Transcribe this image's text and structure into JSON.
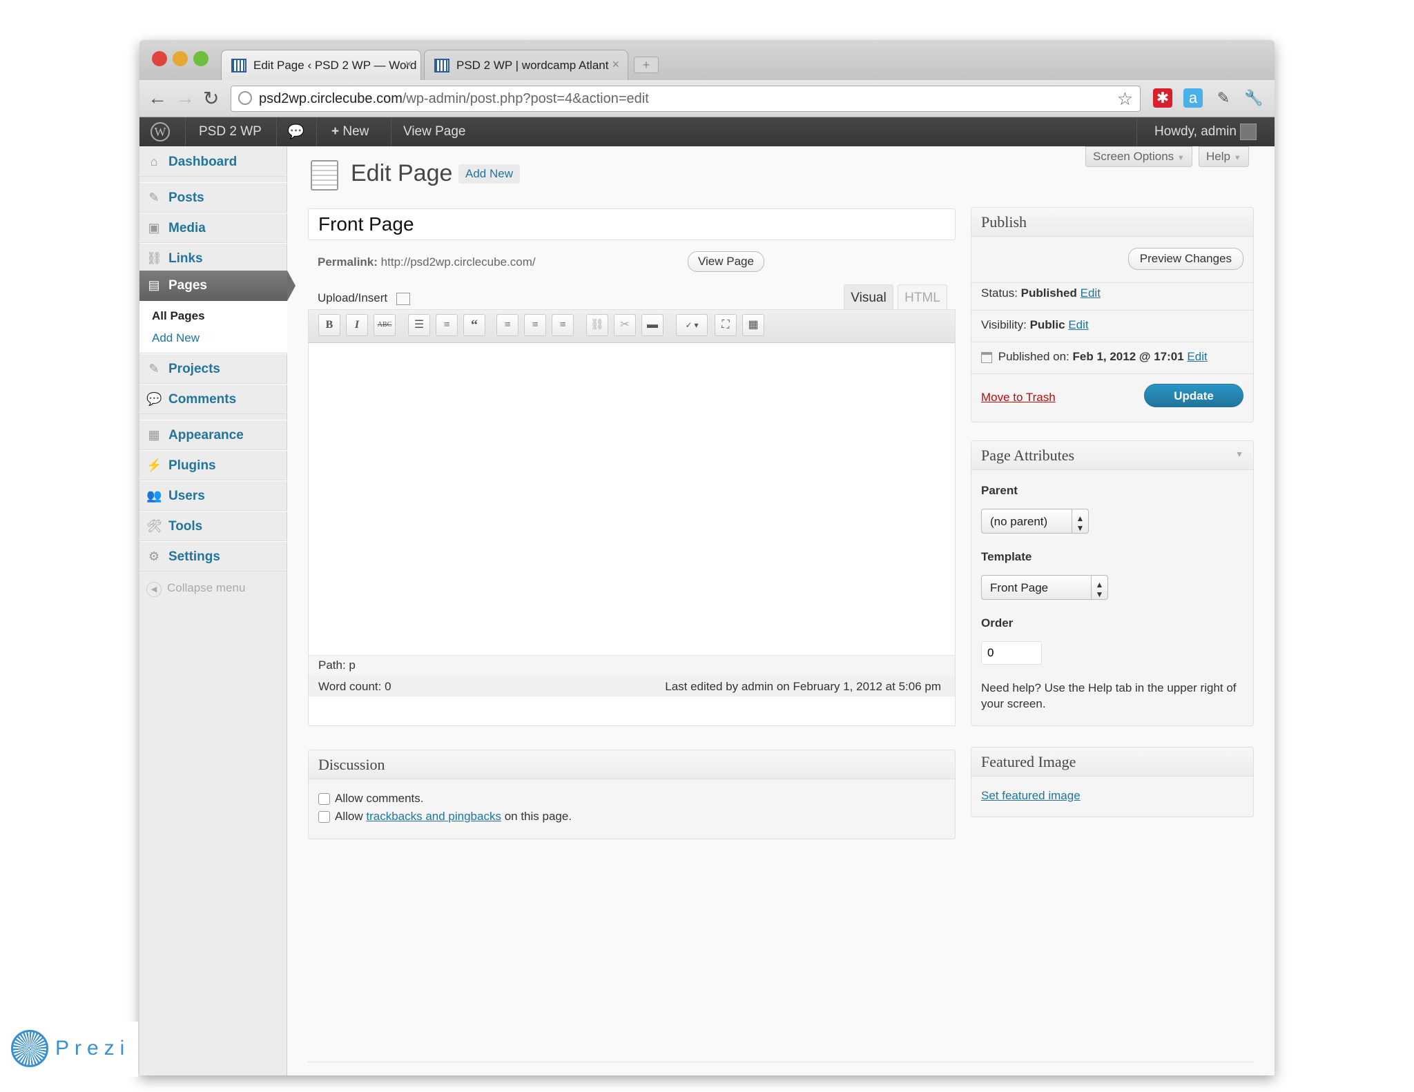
{
  "browser": {
    "tabs": [
      {
        "title": "Edit Page ‹ PSD 2 WP — Word",
        "active": true
      },
      {
        "title": "PSD 2 WP | wordcamp Atlant",
        "active": false
      }
    ],
    "url_host": "psd2wp.circlecube.com",
    "url_path": "/wp-admin/post.php?post=4&action=edit"
  },
  "adminbar": {
    "site_name": "PSD 2 WP",
    "new_label": "New",
    "view_page": "View Page",
    "howdy": "Howdy, admin"
  },
  "sidebar": {
    "items": [
      {
        "label": "Dashboard",
        "icon": "dashboard-icon"
      },
      {
        "label": "Posts",
        "icon": "pin-icon"
      },
      {
        "label": "Media",
        "icon": "media-icon"
      },
      {
        "label": "Links",
        "icon": "link-icon"
      },
      {
        "label": "Pages",
        "icon": "pages-icon"
      },
      {
        "label": "Projects",
        "icon": "pin-icon"
      },
      {
        "label": "Comments",
        "icon": "comment-icon"
      },
      {
        "label": "Appearance",
        "icon": "appearance-icon"
      },
      {
        "label": "Plugins",
        "icon": "plugin-icon"
      },
      {
        "label": "Users",
        "icon": "users-icon"
      },
      {
        "label": "Tools",
        "icon": "tools-icon"
      },
      {
        "label": "Settings",
        "icon": "settings-icon"
      }
    ],
    "submenu": {
      "all_pages": "All Pages",
      "add_new": "Add New"
    },
    "collapse": "Collapse menu"
  },
  "screen_options": "Screen Options",
  "help": "Help",
  "heading": {
    "title": "Edit Page",
    "add_new": "Add New"
  },
  "editor": {
    "post_title": "Front Page",
    "permalink_label": "Permalink:",
    "permalink_url": "http://psd2wp.circlecube.com/",
    "view_page_button": "View Page",
    "upload_insert": "Upload/Insert",
    "tab_visual": "Visual",
    "tab_html": "HTML",
    "path": "Path: p",
    "word_count": "Word count: 0",
    "last_edited": "Last edited by admin on February 1, 2012 at 5:06 pm"
  },
  "discussion": {
    "title": "Discussion",
    "allow_comments": "Allow comments.",
    "allow_prefix": "Allow",
    "trackbacks_link": "trackbacks and pingbacks",
    "allow_suffix": "on this page."
  },
  "publish": {
    "title": "Publish",
    "preview_button": "Preview Changes",
    "status_label": "Status:",
    "status_value": "Published",
    "visibility_label": "Visibility:",
    "visibility_value": "Public",
    "published_on_label": "Published on:",
    "published_on_value": "Feb 1, 2012 @ 17:01",
    "edit": "Edit",
    "move_to_trash": "Move to Trash",
    "update_button": "Update"
  },
  "page_attributes": {
    "title": "Page Attributes",
    "parent_label": "Parent",
    "parent_value": "(no parent)",
    "template_label": "Template",
    "template_value": "Front Page",
    "order_label": "Order",
    "order_value": "0",
    "help_text": "Need help? Use the Help tab in the upper right of your screen."
  },
  "featured_image": {
    "title": "Featured Image",
    "link": "Set featured image"
  },
  "prezi": {
    "logo_text": "Prezi"
  }
}
